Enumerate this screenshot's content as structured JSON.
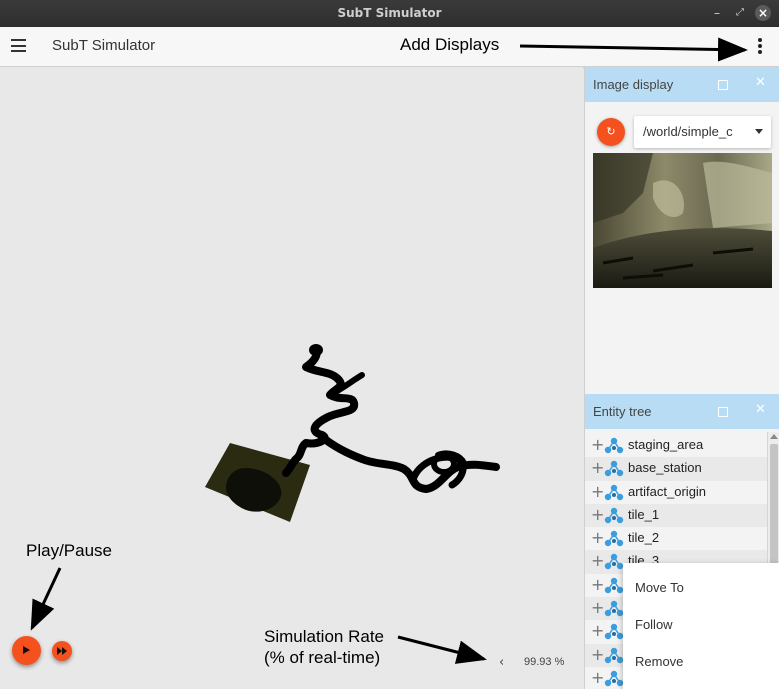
{
  "window": {
    "title": "SubT Simulator"
  },
  "appbar": {
    "title": "SubT Simulator"
  },
  "image_display": {
    "title": "Image display",
    "topic": "/world/simple_c"
  },
  "entity_tree": {
    "title": "Entity tree",
    "items": [
      "staging_area",
      "base_station",
      "artifact_origin",
      "tile_1",
      "tile_2",
      "tile_3",
      "",
      "",
      "",
      "",
      ""
    ]
  },
  "context_menu": {
    "items": [
      "Move To",
      "Follow",
      "Remove"
    ]
  },
  "playback": {
    "rate_chevron": "‹",
    "rate": "99.93 %"
  },
  "annotations": {
    "add_displays": "Add Displays",
    "play_pause": "Play/Pause",
    "sim_rate_line1": "Simulation Rate",
    "sim_rate_line2": "(% of real-time)"
  },
  "icons": {
    "menu": "hamburger-icon",
    "more": "more-vert-icon",
    "refresh": "refresh-icon",
    "play": "play-icon",
    "step": "fast-forward-icon",
    "entity": "model-icon"
  },
  "colors": {
    "accent": "#f4511e",
    "panel_header": "#b9dcf5",
    "entity_icon": "#3b9dde"
  }
}
